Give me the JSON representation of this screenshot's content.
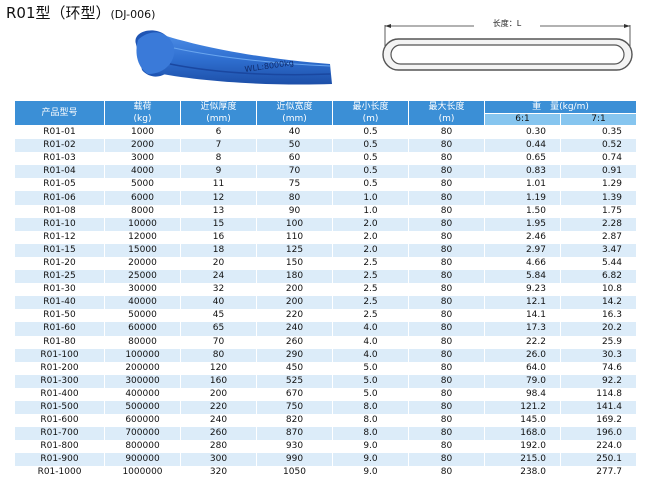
{
  "title": {
    "main": "R01型（环型）",
    "code": "(DJ-006)"
  },
  "photo": {
    "wll_label": "WLL:8000kg",
    "color": "#2f6fd0"
  },
  "diagram": {
    "length_label": "长度：L"
  },
  "table": {
    "headers": {
      "model": "产品型号",
      "load": "载荷",
      "load_unit": "(kg)",
      "thickness": "近似厚度",
      "thickness_unit": "(mm)",
      "width": "近似宽度",
      "width_unit": "(mm)",
      "min_len": "最小长度",
      "min_len_unit": "(m)",
      "max_len": "最大长度",
      "max_len_unit": "(m)",
      "weight": "重　量(kg/m)",
      "ratio6": "6:1",
      "ratio7": "7:1"
    },
    "rows": [
      [
        "R01-01",
        "1000",
        "6",
        "40",
        "0.5",
        "80",
        "0.30",
        "0.35"
      ],
      [
        "R01-02",
        "2000",
        "7",
        "50",
        "0.5",
        "80",
        "0.44",
        "0.52"
      ],
      [
        "R01-03",
        "3000",
        "8",
        "60",
        "0.5",
        "80",
        "0.65",
        "0.74"
      ],
      [
        "R01-04",
        "4000",
        "9",
        "70",
        "0.5",
        "80",
        "0.83",
        "0.91"
      ],
      [
        "R01-05",
        "5000",
        "11",
        "75",
        "0.5",
        "80",
        "1.01",
        "1.29"
      ],
      [
        "R01-06",
        "6000",
        "12",
        "80",
        "1.0",
        "80",
        "1.19",
        "1.39"
      ],
      [
        "R01-08",
        "8000",
        "13",
        "90",
        "1.0",
        "80",
        "1.50",
        "1.75"
      ],
      [
        "R01-10",
        "10000",
        "15",
        "100",
        "2.0",
        "80",
        "1.95",
        "2.28"
      ],
      [
        "R01-12",
        "12000",
        "16",
        "110",
        "2.0",
        "80",
        "2.46",
        "2.87"
      ],
      [
        "R01-15",
        "15000",
        "18",
        "125",
        "2.0",
        "80",
        "2.97",
        "3.47"
      ],
      [
        "R01-20",
        "20000",
        "20",
        "150",
        "2.5",
        "80",
        "4.66",
        "5.44"
      ],
      [
        "R01-25",
        "25000",
        "24",
        "180",
        "2.5",
        "80",
        "5.84",
        "6.82"
      ],
      [
        "R01-30",
        "30000",
        "32",
        "200",
        "2.5",
        "80",
        "9.23",
        "10.8"
      ],
      [
        "R01-40",
        "40000",
        "40",
        "200",
        "2.5",
        "80",
        "12.1",
        "14.2"
      ],
      [
        "R01-50",
        "50000",
        "45",
        "220",
        "2.5",
        "80",
        "14.1",
        "16.3"
      ],
      [
        "R01-60",
        "60000",
        "65",
        "240",
        "4.0",
        "80",
        "17.3",
        "20.2"
      ],
      [
        "R01-80",
        "80000",
        "70",
        "260",
        "4.0",
        "80",
        "22.2",
        "25.9"
      ],
      [
        "R01-100",
        "100000",
        "80",
        "290",
        "4.0",
        "80",
        "26.0",
        "30.3"
      ],
      [
        "R01-200",
        "200000",
        "120",
        "450",
        "5.0",
        "80",
        "64.0",
        "74.6"
      ],
      [
        "R01-300",
        "300000",
        "160",
        "525",
        "5.0",
        "80",
        "79.0",
        "92.2"
      ],
      [
        "R01-400",
        "400000",
        "200",
        "670",
        "5.0",
        "80",
        "98.4",
        "114.8"
      ],
      [
        "R01-500",
        "500000",
        "220",
        "750",
        "8.0",
        "80",
        "121.2",
        "141.4"
      ],
      [
        "R01-600",
        "600000",
        "240",
        "820",
        "8.0",
        "80",
        "145.0",
        "169.2"
      ],
      [
        "R01-700",
        "700000",
        "260",
        "870",
        "8.0",
        "80",
        "168.0",
        "196.0"
      ],
      [
        "R01-800",
        "800000",
        "280",
        "930",
        "9.0",
        "80",
        "192.0",
        "224.0"
      ],
      [
        "R01-900",
        "900000",
        "300",
        "990",
        "9.0",
        "80",
        "215.0",
        "250.1"
      ],
      [
        "R01-1000",
        "1000000",
        "320",
        "1050",
        "9.0",
        "80",
        "238.0",
        "277.7"
      ]
    ]
  }
}
